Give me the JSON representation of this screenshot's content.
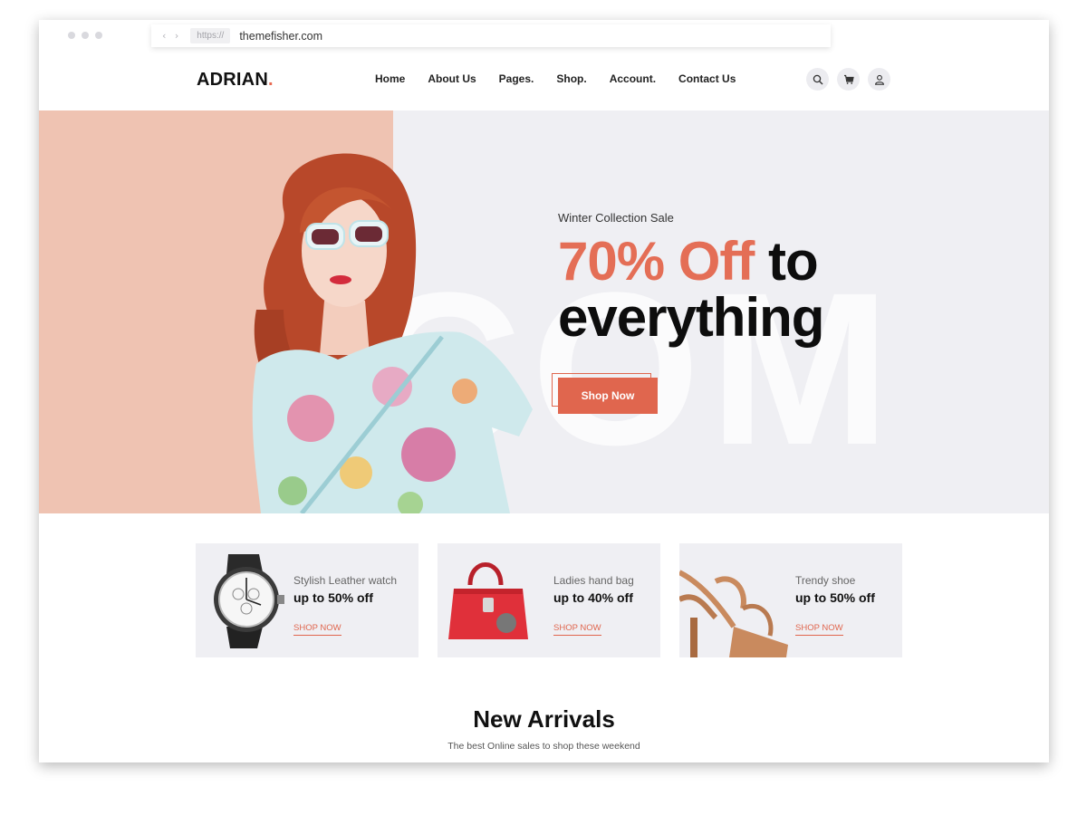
{
  "browser": {
    "nav_arrows": "‹ ›",
    "protocol": "https://",
    "domain": "themefisher.com"
  },
  "header": {
    "logo_text": "ADRIAN",
    "logo_dot": ".",
    "nav": [
      "Home",
      "About Us",
      "Pages.",
      "Shop.",
      "Account.",
      "Contact Us"
    ],
    "icons": [
      "search-icon",
      "cart-icon",
      "user-icon"
    ]
  },
  "hero": {
    "eyebrow": "Winter Collection Sale",
    "headline_accent": "70% Off",
    "headline_rest_1": " to",
    "headline_rest_2": "everything",
    "watermark": "COM",
    "button_label": "Shop Now"
  },
  "products": [
    {
      "name": "Stylish Leather watch",
      "offer": "up to 50% off",
      "link": "SHOP NOW",
      "icon": "watch-image"
    },
    {
      "name": "Ladies hand bag",
      "offer": "up to 40% off",
      "link": "SHOP NOW",
      "icon": "handbag-image"
    },
    {
      "name": "Trendy shoe",
      "offer": "up to 50% off",
      "link": "SHOP NOW",
      "icon": "shoe-image"
    }
  ],
  "arrivals": {
    "title": "New Arrivals",
    "subtitle": "The best Online sales to shop these weekend"
  },
  "colors": {
    "accent": "#e0664e",
    "hero_peach": "#efc3b2",
    "hero_bg": "#efeff3"
  }
}
